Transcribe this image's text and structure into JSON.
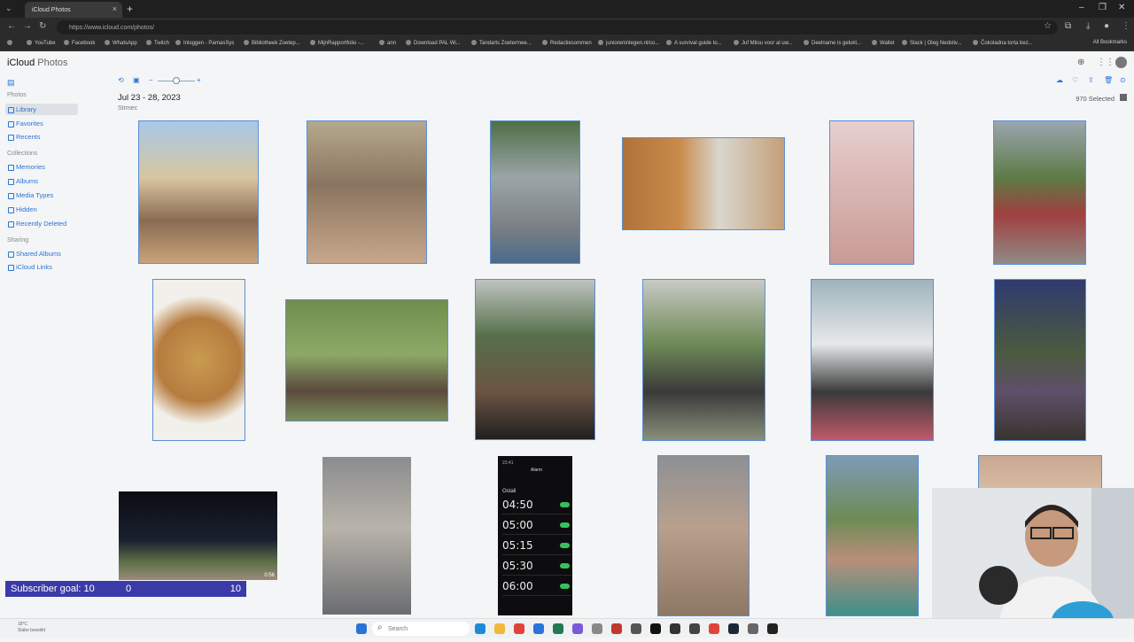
{
  "browser": {
    "tab_title": "iCloud Photos",
    "url": "https://www.icloud.com/photos/",
    "bookmarks": [
      "YouTube",
      "Facebook",
      "WhatsApp",
      "Twitch",
      "Inloggen - ParnasSys",
      "Bibliotheek Zoetер...",
      "MijnRapportfolio -...",
      "ann",
      "Download PAL Wi...",
      "Tandarts Zoetermee...",
      "Redactiesommen",
      "juniorenintegen.nl/co...",
      "A survival guide to...",
      "Juf Milou voor al uw...",
      "Deelname is gelukt...",
      "Wallet",
      "Slack | Oleg Nedoliv...",
      "Čokoladna torta bez..."
    ],
    "all_bookmarks": "All Bookmarks"
  },
  "app": {
    "logo_brand": "iCloud",
    "logo_product": " Photos"
  },
  "sidebar": {
    "photos_section": "Photos",
    "photos_items": [
      "Library",
      "Favorites",
      "Recents"
    ],
    "collections_section": "Collections",
    "collections_items": [
      "Memories",
      "Albums",
      "Media Types",
      "Hidden",
      "Recently Deleted"
    ],
    "sharing_section": "Sharing",
    "sharing_items": [
      "Shared Albums",
      "iCloud Links"
    ]
  },
  "main": {
    "date_range": "Jul 23 - 28, 2023",
    "location": "Strmec",
    "selected_count": "970 Selected",
    "zoom_minus": "−",
    "zoom_plus": "+",
    "video_duration": "0:56"
  },
  "alarm_screenshot": {
    "header": "Alarm",
    "section": "Ostali",
    "times": [
      "04:50",
      "05:00",
      "05:15",
      "05:30",
      "06:00"
    ]
  },
  "overlay": {
    "subscriber_label": "Subscriber goal: 10",
    "subscriber_current": "0",
    "subscriber_target": "10"
  },
  "taskbar": {
    "weather_temp": "18°C",
    "weather_desc": "Slabo bewolkt",
    "search_placeholder": "Search"
  }
}
